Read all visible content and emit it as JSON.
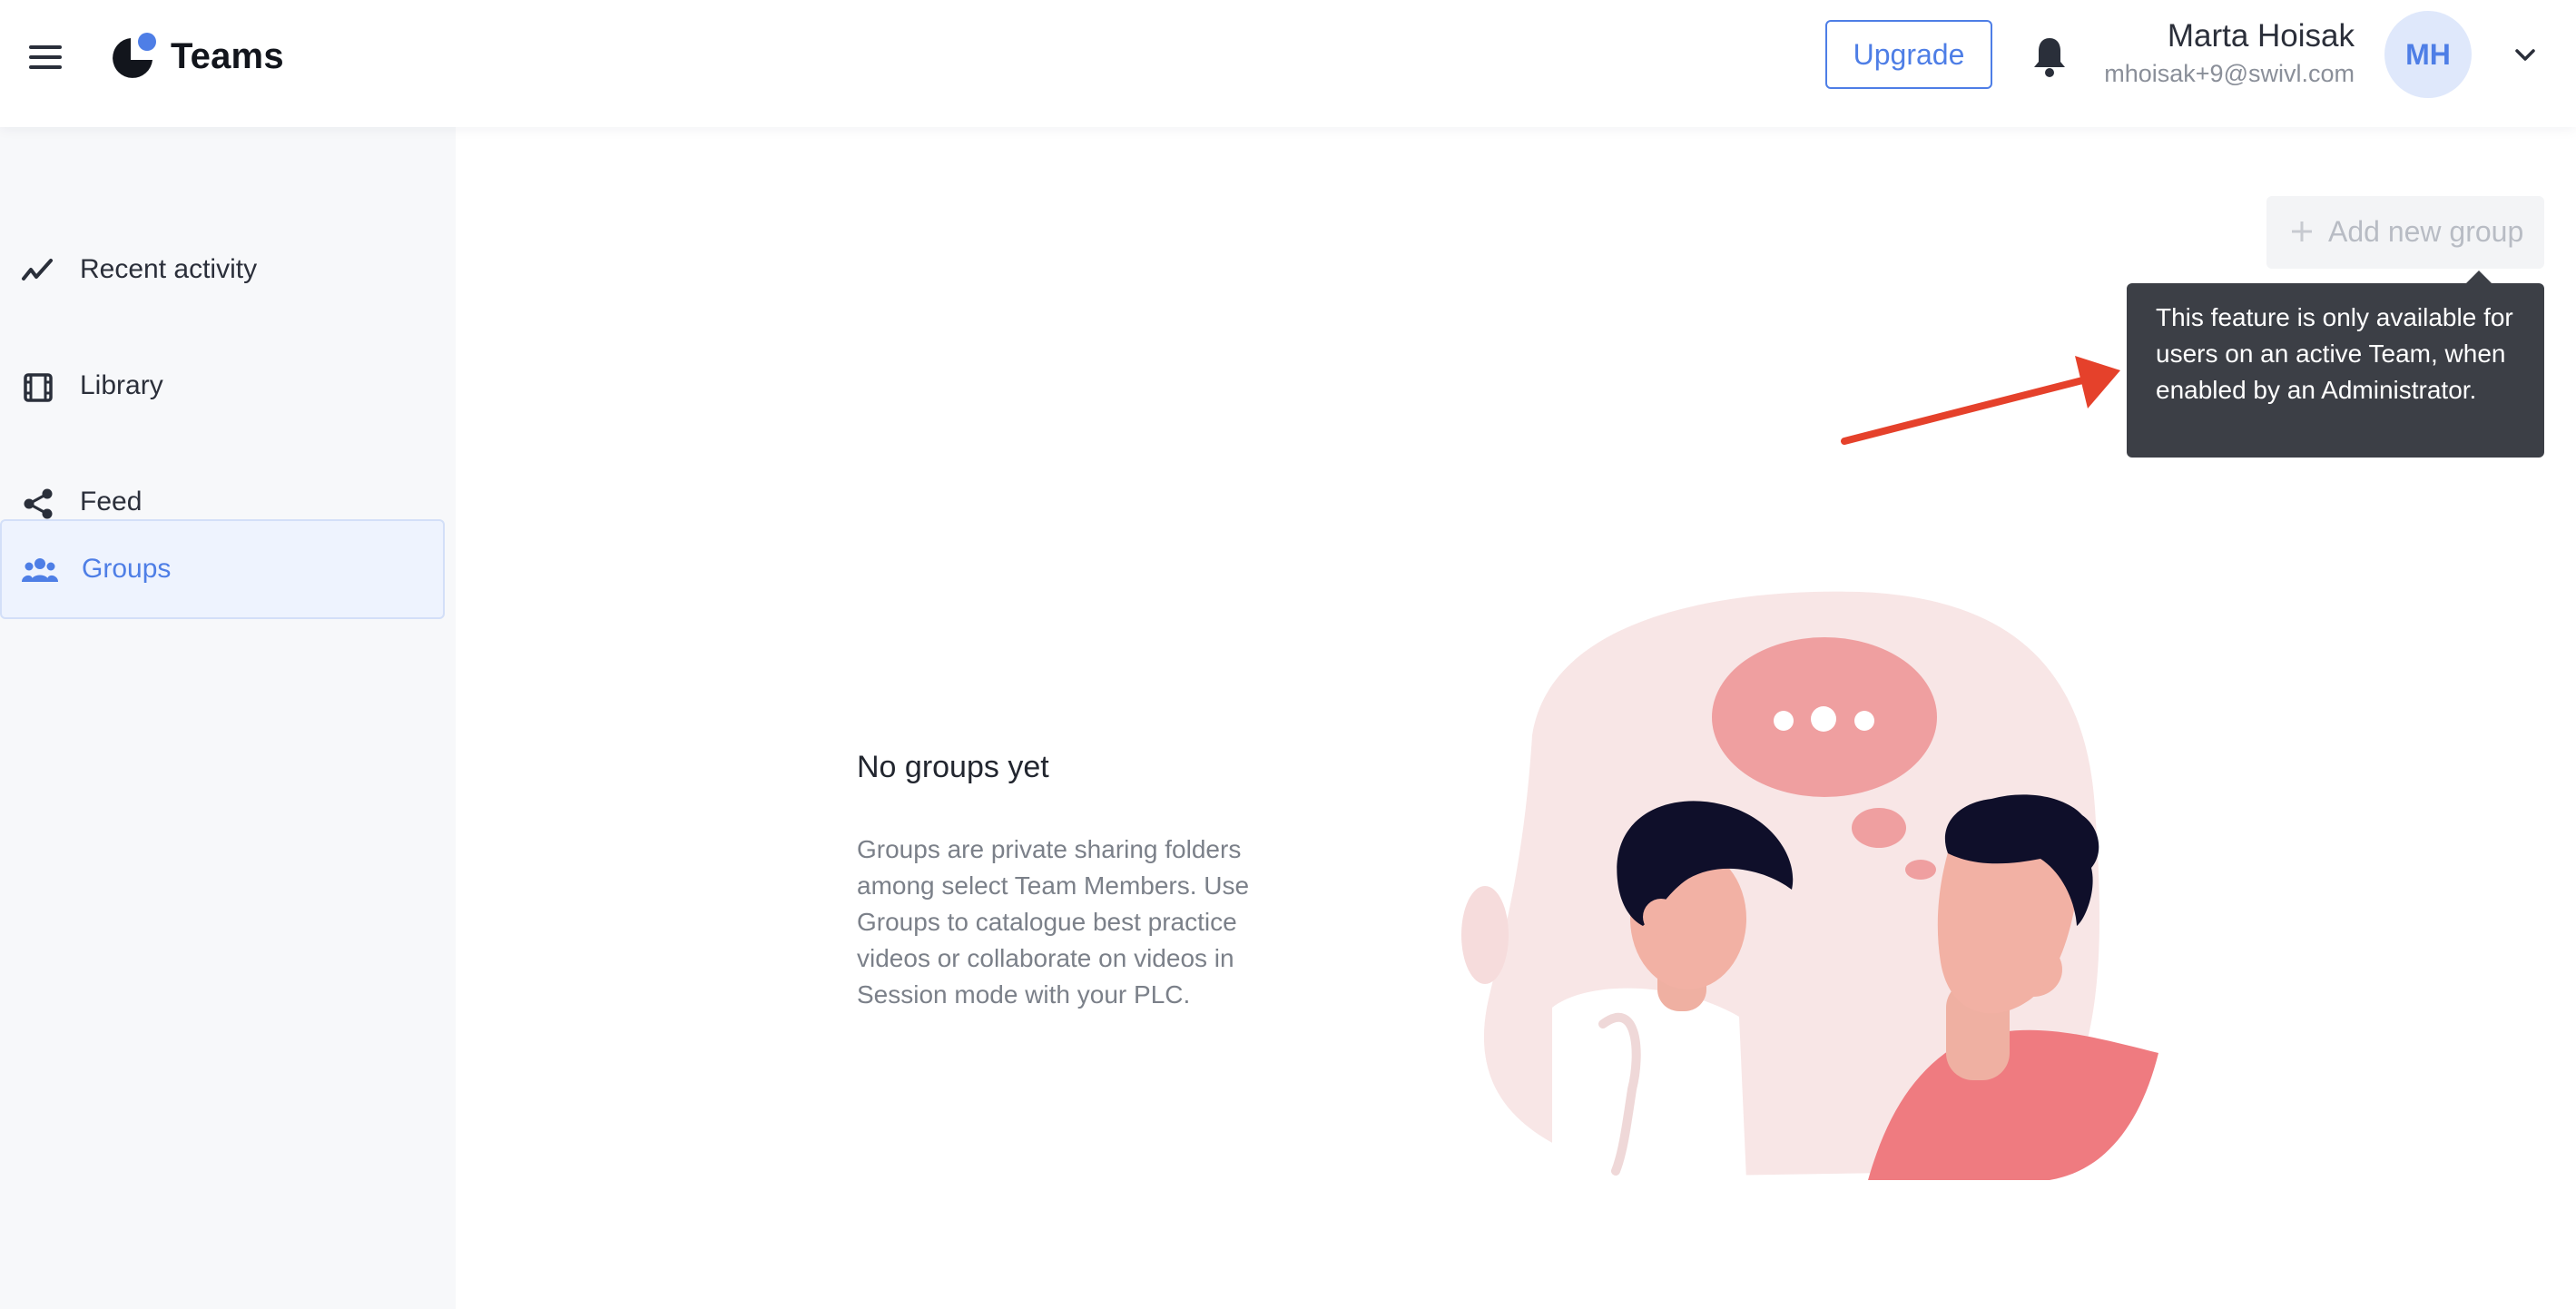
{
  "header": {
    "app_title": "Teams",
    "upgrade_label": "Upgrade",
    "user": {
      "name": "Marta Hoisak",
      "email": "mhoisak+9@swivl.com",
      "initials": "MH"
    }
  },
  "sidebar": {
    "items": [
      {
        "label": "Recent activity",
        "icon": "activity-icon"
      },
      {
        "label": "Library",
        "icon": "film-icon"
      },
      {
        "label": "Feed",
        "icon": "share-icon"
      },
      {
        "label": "Groups",
        "icon": "users-icon",
        "active": true
      }
    ]
  },
  "main": {
    "add_group_label": "Add new group",
    "tooltip": "This feature is only available for users on an active Team, when enabled by an Administrator.",
    "empty_state": {
      "title": "No groups yet",
      "description": "Groups are private sharing folders among select Team Members. Use Groups to catalogue best practice videos or collaborate on videos in Session mode with your PLC."
    }
  },
  "colors": {
    "accent": "#4e7ee6",
    "tooltip_bg": "#3c3f46",
    "annotation_arrow": "#e5412b",
    "illustration_blob": "#f8e6e6",
    "illustration_coral": "#ef7b80"
  }
}
